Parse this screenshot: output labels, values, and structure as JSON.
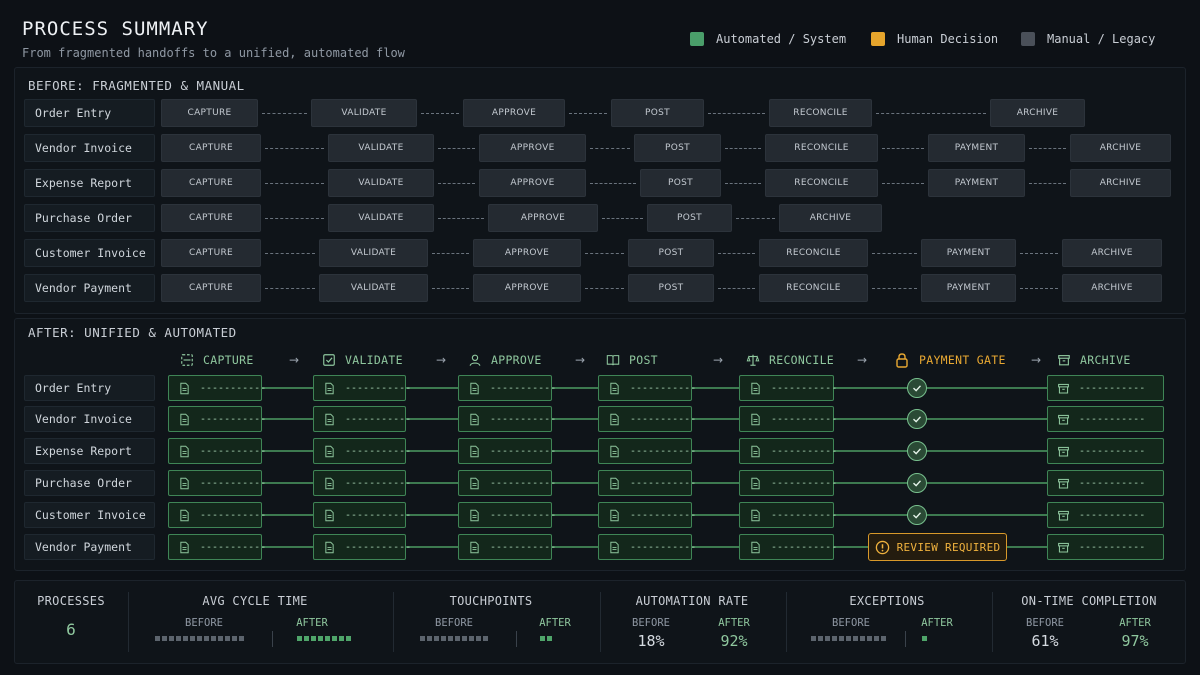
{
  "header": {
    "title": "PROCESS SUMMARY",
    "subtitle": "From fragmented handoffs to a unified, automated flow"
  },
  "legend": [
    {
      "label": "Automated / System",
      "color": "#4a9e6a"
    },
    {
      "label": "Human Decision",
      "color": "#e6a52c"
    },
    {
      "label": "Manual / Legacy",
      "color": "#4a5059"
    }
  ],
  "before": {
    "title": "BEFORE: FRAGMENTED & MANUAL",
    "rows": [
      {
        "label": "Order Entry",
        "steps": [
          "CAPTURE",
          "VALIDATE",
          "APPROVE",
          "POST",
          "RECONCILE",
          "ARCHIVE"
        ]
      },
      {
        "label": "Vendor Invoice",
        "steps": [
          "CAPTURE",
          "VALIDATE",
          "APPROVE",
          "POST",
          "RECONCILE",
          "PAYMENT",
          "ARCHIVE"
        ]
      },
      {
        "label": "Expense Report",
        "steps": [
          "CAPTURE",
          "VALIDATE",
          "APPROVE",
          "POST",
          "RECONCILE",
          "PAYMENT",
          "ARCHIVE"
        ]
      },
      {
        "label": "Purchase Order",
        "steps": [
          "CAPTURE",
          "VALIDATE",
          "APPROVE",
          "POST",
          "ARCHIVE"
        ]
      },
      {
        "label": "Customer Invoice",
        "steps": [
          "CAPTURE",
          "VALIDATE",
          "APPROVE",
          "POST",
          "RECONCILE",
          "PAYMENT",
          "ARCHIVE"
        ]
      },
      {
        "label": "Vendor Payment",
        "steps": [
          "CAPTURE",
          "VALIDATE",
          "APPROVE",
          "POST",
          "RECONCILE",
          "PAYMENT",
          "ARCHIVE"
        ]
      }
    ]
  },
  "after": {
    "title": "AFTER: UNIFIED & AUTOMATED",
    "columns": [
      {
        "label": "CAPTURE",
        "icon": "scan-icon"
      },
      {
        "label": "VALIDATE",
        "icon": "checkbox-icon"
      },
      {
        "label": "APPROVE",
        "icon": "user-icon"
      },
      {
        "label": "POST",
        "icon": "book-icon"
      },
      {
        "label": "RECONCILE",
        "icon": "scale-icon"
      },
      {
        "label": "PAYMENT GATE",
        "icon": "lock-icon"
      },
      {
        "label": "ARCHIVE",
        "icon": "archive-icon"
      }
    ],
    "placeholder": "-----------",
    "rows": [
      {
        "label": "Order Entry",
        "gate": "check"
      },
      {
        "label": "Vendor Invoice",
        "gate": "check"
      },
      {
        "label": "Expense Report",
        "gate": "check"
      },
      {
        "label": "Purchase Order",
        "gate": "check"
      },
      {
        "label": "Customer Invoice",
        "gate": "check"
      },
      {
        "label": "Vendor Payment",
        "gate": "review"
      }
    ],
    "review_label": "REVIEW REQUIRED"
  },
  "stats": {
    "before_label": "BEFORE",
    "after_label": "AFTER",
    "processes": {
      "title": "PROCESSES",
      "value": "6"
    },
    "cycle_time": {
      "title": "AVG CYCLE TIME",
      "before_units": 13,
      "after_units": 8
    },
    "touchpoints": {
      "title": "TOUCHPOINTS",
      "before_units": 10,
      "after_units": 2
    },
    "automation_rate": {
      "title": "AUTOMATION RATE",
      "before": "18%",
      "after": "92%"
    },
    "exceptions": {
      "title": "EXCEPTIONS",
      "before_units": 11,
      "after_units": 1
    },
    "on_time": {
      "title": "ON-TIME COMPLETION",
      "before": "61%",
      "after": "97%"
    }
  }
}
